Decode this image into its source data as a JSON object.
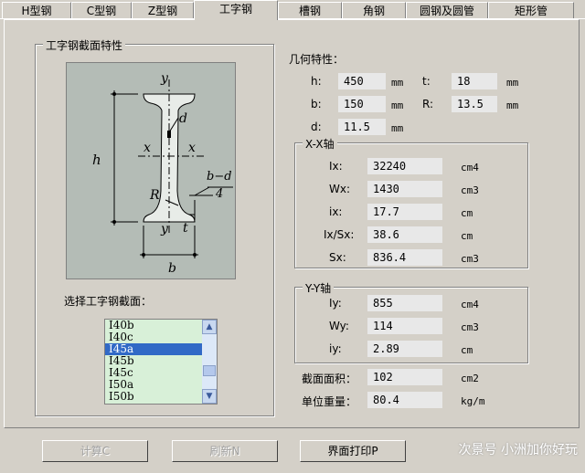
{
  "tabs": [
    "H型钢",
    "C型钢",
    "Z型钢",
    "工字钢",
    "槽钢",
    "角钢",
    "圆钢及圆管",
    "矩形管"
  ],
  "section_group_title": "工字钢截面特性",
  "geometry_group_title": "几何特性：",
  "geometry": {
    "h_label": "h:",
    "h_value": "450",
    "h_unit": "mm",
    "t_label": "t:",
    "t_value": "18",
    "t_unit": "mm",
    "b_label": "b:",
    "b_value": "150",
    "b_unit": "mm",
    "R_label": "R:",
    "R_value": "13.5",
    "R_unit": "mm",
    "d_label": "d:",
    "d_value": "11.5",
    "d_unit": "mm"
  },
  "xx_group_title": "X-X轴",
  "xx": {
    "Ix_label": "Ix:",
    "Ix_value": "32240",
    "Ix_unit": "cm4",
    "Wx_label": "Wx:",
    "Wx_value": "1430",
    "Wx_unit": "cm3",
    "ix_label": "ix:",
    "ix_value": "17.7",
    "ix_unit": "cm",
    "IxSx_label": "Ix/Sx:",
    "IxSx_value": "38.6",
    "IxSx_unit": "cm",
    "Sx_label": "Sx:",
    "Sx_value": "836.4",
    "Sx_unit": "cm3"
  },
  "yy_group_title": "Y-Y轴",
  "yy": {
    "Iy_label": "Iy:",
    "Iy_value": "855",
    "Iy_unit": "cm4",
    "Wy_label": "Wy:",
    "Wy_value": "114",
    "Wy_unit": "cm3",
    "iy_label": "iy:",
    "iy_value": "2.89",
    "iy_unit": "cm"
  },
  "area_label": "截面面积：",
  "area_value": "102",
  "area_unit": "cm2",
  "weight_label": "单位重量：",
  "weight_value": "80.4",
  "weight_unit": "kg/m",
  "select_label": "选择工字钢截面：",
  "sections": [
    "I40b",
    "I40c",
    "I45a",
    "I45b",
    "I45c",
    "I50a",
    "I50b"
  ],
  "selected_section": "I45a",
  "figure_labels": {
    "y_top": "y",
    "y_bottom": "y",
    "x_left": "x",
    "x_right": "x",
    "h": "h",
    "b": "b",
    "d": "d",
    "R": "R",
    "t": "t",
    "bd_num": "b−d",
    "bd_den": "4"
  },
  "buttons": {
    "calc": "计算C",
    "refresh": "刷新N",
    "print": "界面打印P"
  },
  "watermark": "次景号 小洲加你好玩"
}
